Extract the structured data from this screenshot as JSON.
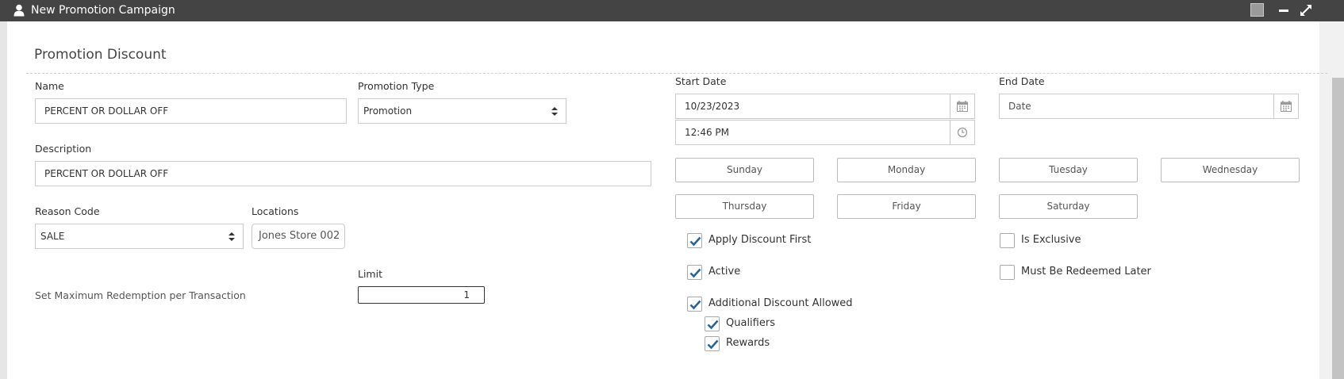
{
  "window": {
    "title": "New Promotion Campaign",
    "icons": {
      "title": "user-icon",
      "min": "minimize-icon",
      "max": "maximize-icon"
    }
  },
  "section": {
    "title": "Promotion Discount"
  },
  "form": {
    "name": {
      "label": "Name",
      "value": "PERCENT OR DOLLAR OFF"
    },
    "promotion_type": {
      "label": "Promotion Type",
      "value": "Promotion"
    },
    "description": {
      "label": "Description",
      "value": "PERCENT OR DOLLAR OFF"
    },
    "reason_code": {
      "label": "Reason Code",
      "value": "SALE"
    },
    "locations": {
      "label": "Locations",
      "value": "Jones Store 002"
    },
    "max_redemption": {
      "label": "Set Maximum Redemption per Transaction",
      "limit_label": "Limit",
      "limit_value": "1"
    },
    "start_date": {
      "label": "Start Date",
      "date_value": "10/23/2023",
      "time_value": "12:46 PM"
    },
    "end_date": {
      "label": "End Date",
      "placeholder": "Date"
    }
  },
  "days": [
    "Sunday",
    "Monday",
    "Tuesday",
    "Wednesday",
    "Thursday",
    "Friday",
    "Saturday"
  ],
  "checkboxes": {
    "apply_discount_first": {
      "label": "Apply Discount First",
      "checked": true
    },
    "active": {
      "label": "Active",
      "checked": true
    },
    "additional_discount_allowed": {
      "label": "Additional Discount Allowed",
      "checked": true
    },
    "qualifiers": {
      "label": "Qualifiers",
      "checked": true
    },
    "rewards": {
      "label": "Rewards",
      "checked": true
    },
    "is_exclusive": {
      "label": "Is Exclusive",
      "checked": false
    },
    "must_be_redeemed_later": {
      "label": "Must Be Redeemed Later",
      "checked": false
    }
  },
  "colors": {
    "titlebar": "#444444",
    "check": "#2a6496",
    "border": "#cccccc"
  }
}
